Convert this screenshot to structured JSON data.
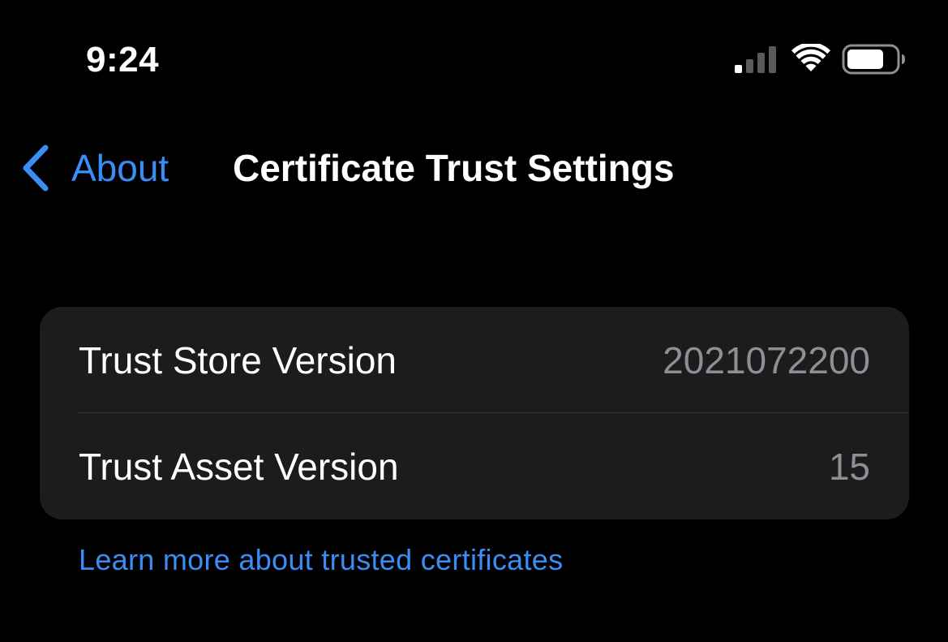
{
  "status_bar": {
    "time": "9:24",
    "icons": [
      "signal-icon",
      "wifi-icon",
      "battery-icon"
    ]
  },
  "nav": {
    "back_label": "About",
    "title": "Certificate Trust Settings"
  },
  "trust_info": {
    "rows": [
      {
        "label": "Trust Store Version",
        "value": "2021072200"
      },
      {
        "label": "Trust Asset Version",
        "value": "15"
      }
    ]
  },
  "footer": {
    "link_text": "Learn more about trusted certificates"
  },
  "colors": {
    "background": "#000000",
    "accent": "#3a8df5",
    "group_background": "#1c1c1e",
    "secondary_text": "#8e8e93"
  }
}
